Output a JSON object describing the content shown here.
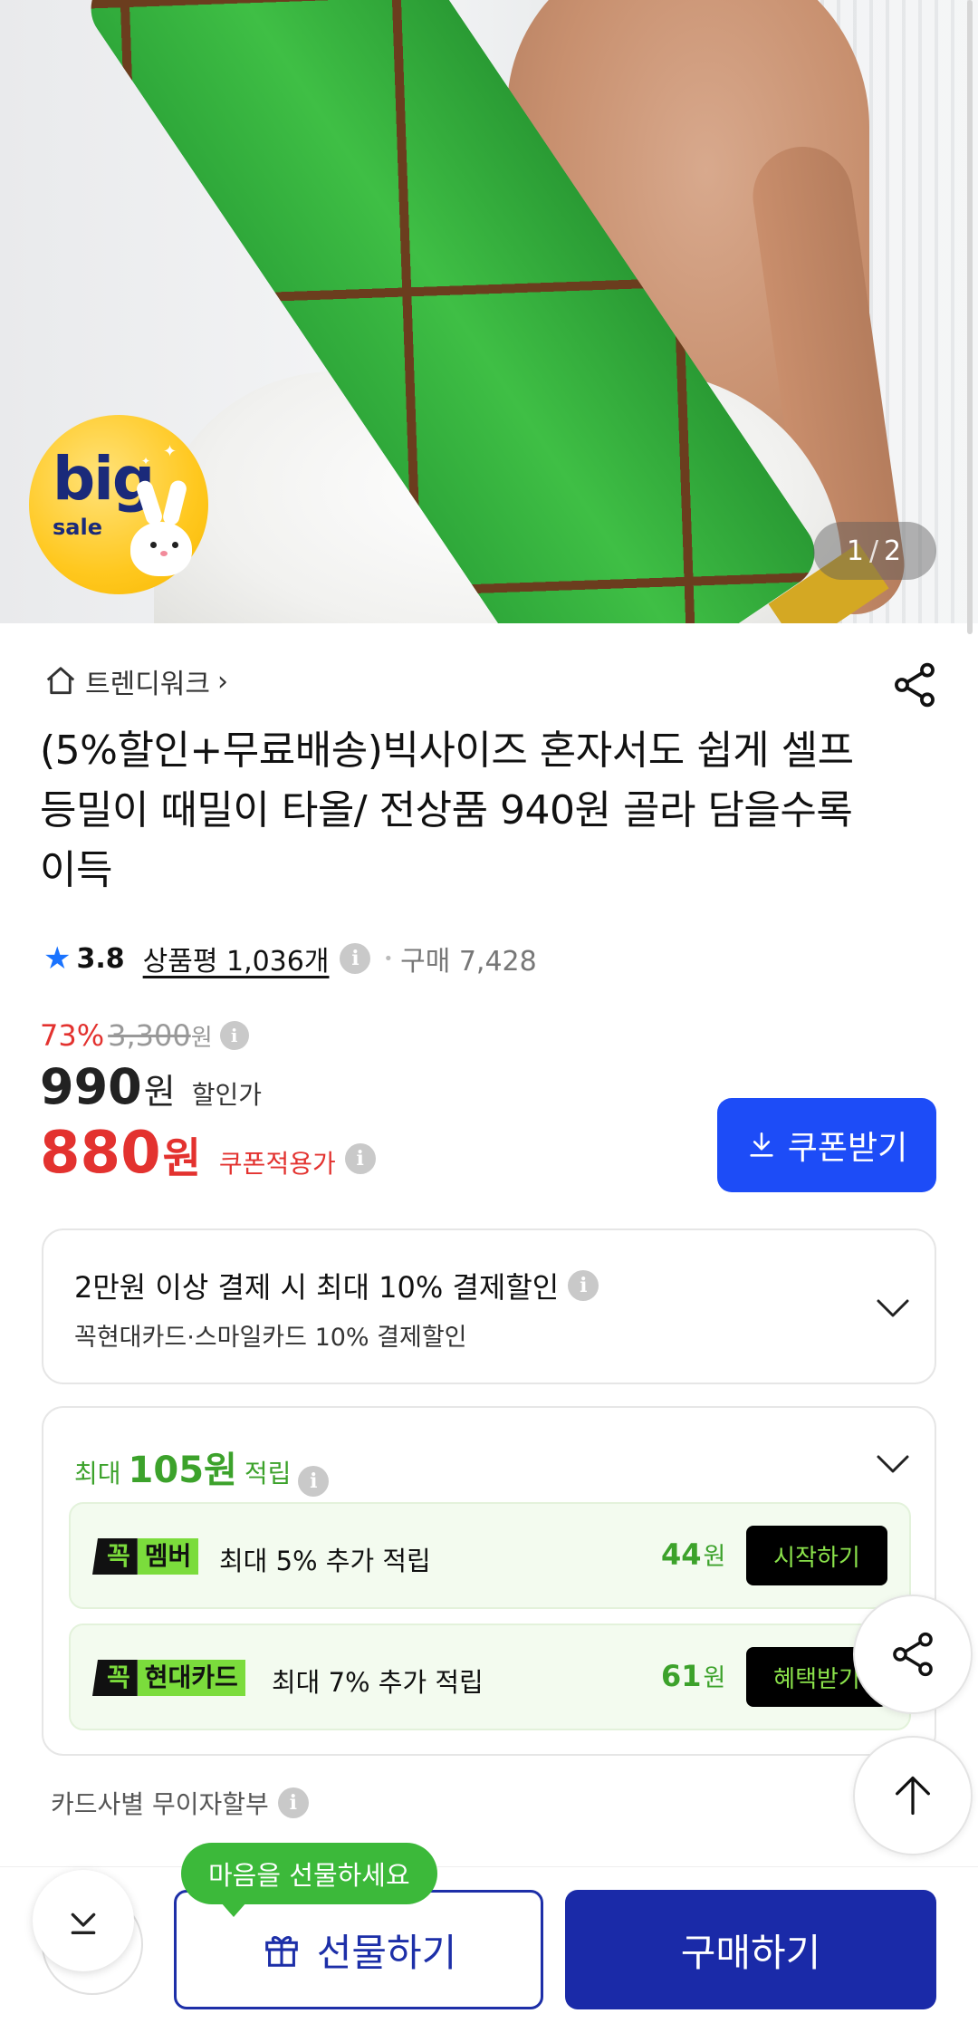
{
  "gallery": {
    "current": "1",
    "total": "2",
    "separator": "/",
    "badge_big": "big",
    "badge_sale": "sale"
  },
  "seller": {
    "name": "트렌디워크",
    "chevron": "›"
  },
  "product": {
    "title": "(5%할인+무료배송)빅사이즈 혼자서도 쉽게 셀프 등밀이 때밀이 타올/ 전상품 940원 골라 담을수록 이득",
    "rating": "3.8",
    "reviews_label": "상품평 1,036개",
    "purchases": "구매 7,428"
  },
  "price": {
    "discount_pct": "73%",
    "original": "3,300",
    "original_unit": "원",
    "sale": "990",
    "sale_unit": "원",
    "sale_label": "할인가",
    "coupon": "880",
    "coupon_unit": "원",
    "coupon_label": "쿠폰적용가",
    "coupon_button": "쿠폰받기"
  },
  "payment_discount": {
    "title": "2만원 이상 결제 시 최대 10% 결제할인",
    "subtitle": "꼭현대카드·스마일카드 10% 결제할인"
  },
  "points": {
    "prefix": "최대",
    "amount": "105원",
    "suffix": "적립",
    "rows": [
      {
        "tag_k": "꼭",
        "tag_name": "멤버",
        "desc": "최대 5% 추가 적립",
        "amount": "44",
        "unit": "원",
        "action": "시작하기"
      },
      {
        "tag_k": "꼭",
        "tag_name": "현대카드",
        "desc": "최대 7% 추가 적립",
        "amount": "61",
        "unit": "원",
        "action": "혜택받기"
      }
    ]
  },
  "installment": "카드사별 무이자할부",
  "bottom": {
    "gift_bubble": "마음을 선물하세요",
    "gift": "선물하기",
    "buy": "구매하기"
  },
  "colors": {
    "accent_blue": "#1d4cf7",
    "buy_navy": "#1a2aa8",
    "sale_red": "#e3322f",
    "points_green": "#3ca22b",
    "bubble_green": "#3cb93a"
  },
  "icons": [
    "home-icon",
    "share-icon",
    "star-icon",
    "info-icon",
    "download-icon",
    "chevron-down-icon",
    "arrow-up-icon",
    "gift-icon"
  ]
}
